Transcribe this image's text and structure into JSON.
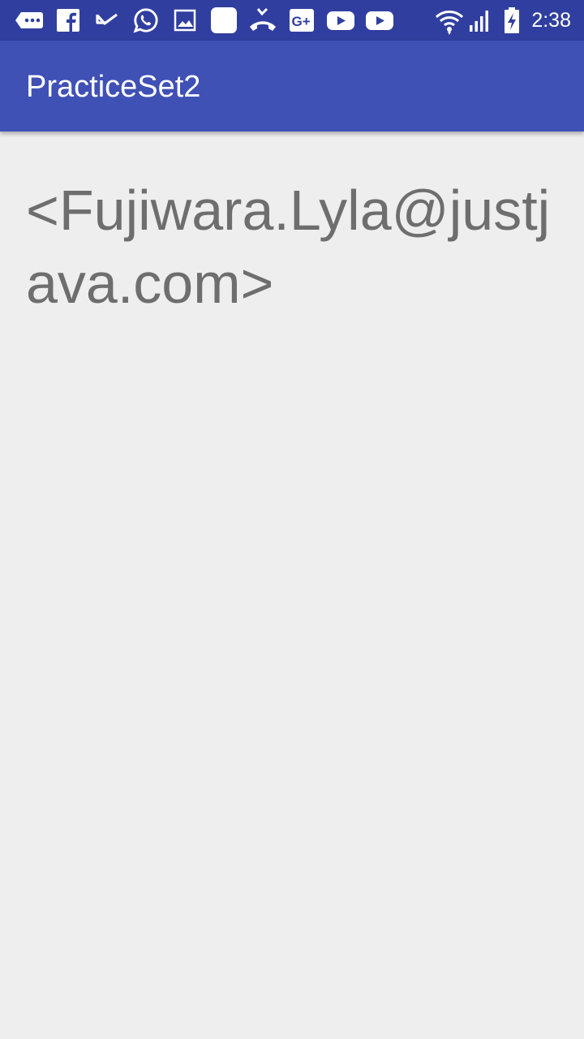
{
  "status_bar": {
    "time": "2:38",
    "left_icons": [
      "messages-icon",
      "facebook-icon",
      "missed-call-icon",
      "whatsapp-icon",
      "image-icon",
      "app-icon",
      "phone-missed-icon",
      "google-plus-icon",
      "youtube-icon",
      "youtube-icon"
    ],
    "right_icons": [
      "wifi-icon",
      "signal-icon",
      "battery-charging-icon"
    ],
    "colors": {
      "background": "#303f9f",
      "foreground": "#ffffff"
    }
  },
  "app_bar": {
    "title": "PracticeSet2",
    "color": "#3f51b5"
  },
  "main": {
    "email_text": "<Fujiwara.Lyla@justjava.com>",
    "text_color": "#6e6e6e",
    "background": "#eeeeee"
  }
}
